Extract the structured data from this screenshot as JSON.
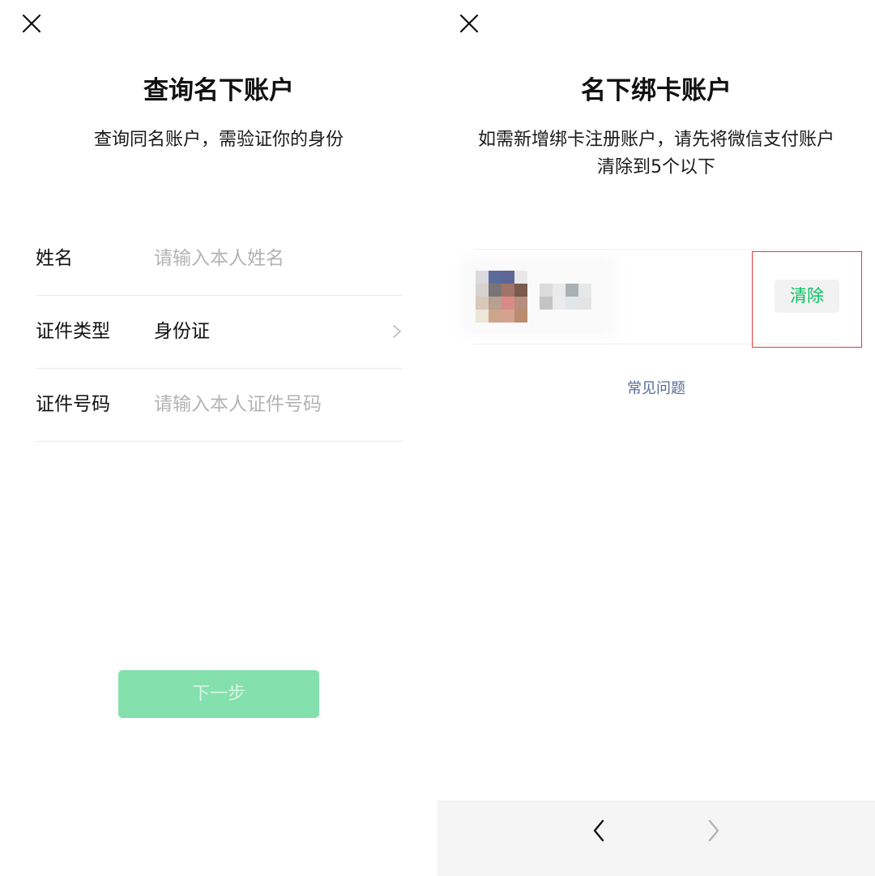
{
  "left": {
    "close_icon": "close-icon",
    "title": "查询名下账户",
    "subtitle": "查询同名账户，需验证你的身份",
    "form": {
      "name_label": "姓名",
      "name_placeholder": "请输入本人姓名",
      "id_type_label": "证件类型",
      "id_type_value": "身份证",
      "id_number_label": "证件号码",
      "id_number_placeholder": "请输入本人证件号码"
    },
    "next_button": "下一步"
  },
  "right": {
    "close_icon": "close-icon",
    "title": "名下绑卡账户",
    "subtitle": "如需新增绑卡注册账户，请先将微信支付账户清除到5个以下",
    "account": {
      "avatar": "pixelated-avatar",
      "name": "pixelated-account-name"
    },
    "clear_button": "清除",
    "faq_link": "常见问题",
    "nav": {
      "back_icon": "chevron-left-icon",
      "forward_icon": "chevron-right-icon"
    }
  },
  "colors": {
    "accent_green": "#07c160",
    "button_disabled_green": "#84e0ad",
    "link_blue": "#576b95",
    "highlight_red": "#e23a3a",
    "placeholder_gray": "#b3b3b3"
  }
}
